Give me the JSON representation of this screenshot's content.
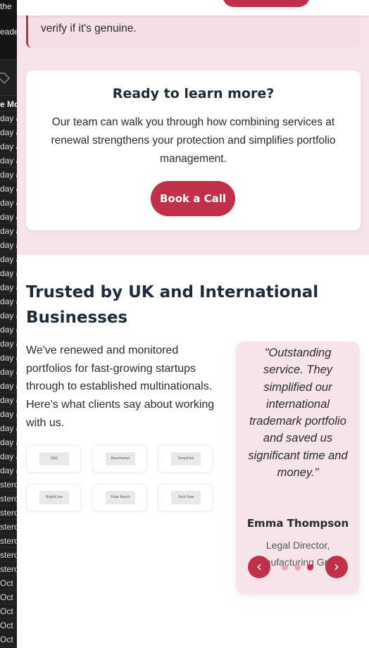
{
  "background_app": {
    "top_lines": [
      "the",
      "eade"
    ],
    "header_row": "e Mo",
    "rows": [
      "day a",
      "day a",
      "day a",
      "day a",
      "day a",
      "day a",
      "day a",
      "day a",
      "day a",
      "day a",
      "day a",
      "day a",
      "day a",
      "day a",
      "day a",
      "day a",
      "day a",
      "day a",
      "day a",
      "day a",
      "day a",
      "day a",
      "day a",
      "day a",
      "day a",
      "day a",
      "stero",
      "stero",
      "stero",
      "stero",
      "stero",
      "stero",
      "stero",
      "Oct",
      "Oct",
      "Oct",
      "Oct",
      "Oct",
      "Oct"
    ]
  },
  "notice": {
    "text": "verify if it's genuine."
  },
  "cta": {
    "title": "Ready to learn more?",
    "text": "Our team can walk you through how combining services at renewal strengthens your protection and simplifies portfolio management.",
    "button": "Book a Call"
  },
  "trusted": {
    "title": "Trusted by UK and International Businesses",
    "text": "We've renewed and monitored portfolios for fast-growing startups through to established multinationals. Here's what clients say about working with us.",
    "logos": [
      "SSG",
      "Beechwood",
      "SmartHub",
      "BrightCore",
      "Polar Bench",
      "Tech Flow"
    ]
  },
  "testimonial": {
    "quote": "\"Outstanding service. They simplified our international trademark portfolio and saved us significant time and money.\"",
    "author": "Emma Thompson",
    "role": "Legal Director, Manufacturing Group",
    "prev": "‹",
    "next": "›",
    "active_dot": 3,
    "dot_count": 3
  },
  "colors": {
    "accent": "#c0304a",
    "section_bg": "#f6e4e9",
    "heading": "#1d2b3a"
  }
}
